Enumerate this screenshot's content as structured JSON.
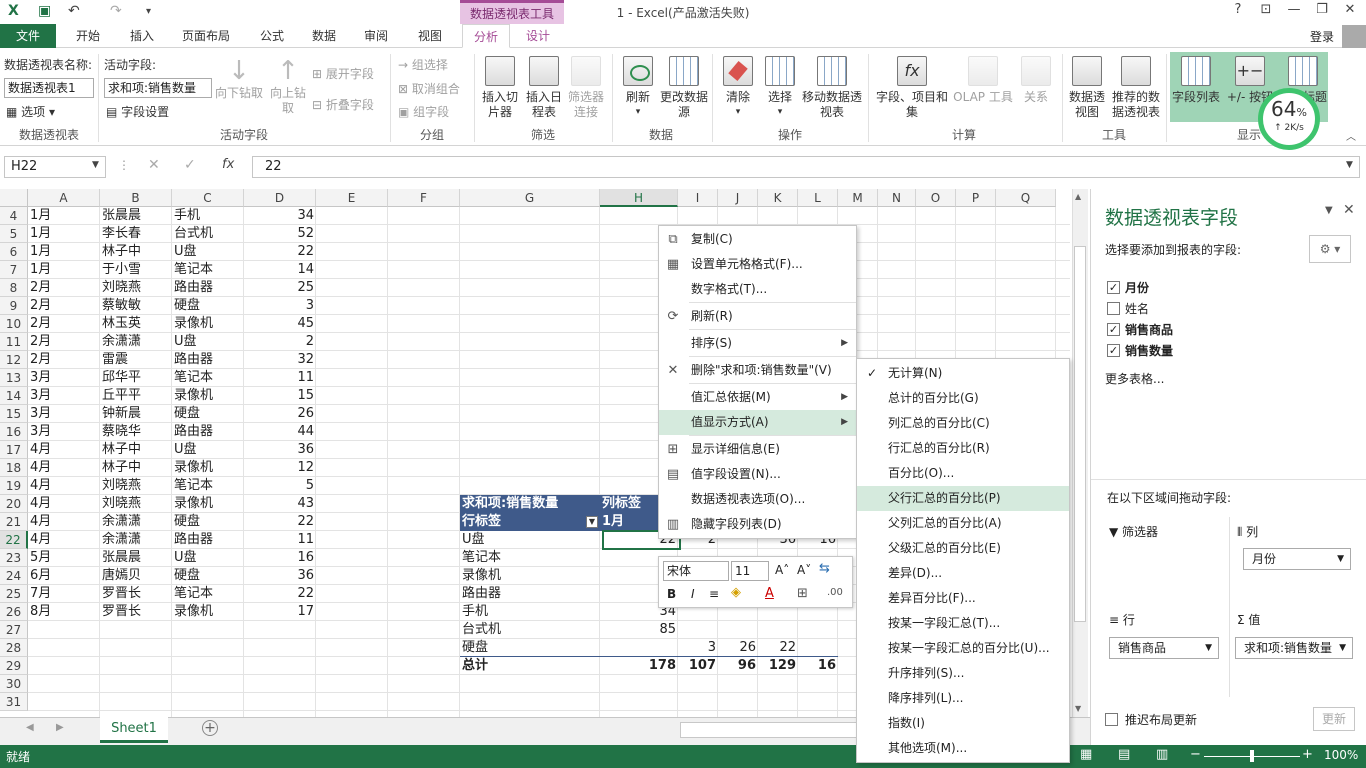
{
  "app": {
    "title": "1 - Excel(产品激活失败)",
    "context_tab_group": "数据透视表工具",
    "login": "登录",
    "help": "?"
  },
  "tabs": [
    "文件",
    "开始",
    "插入",
    "页面布局",
    "公式",
    "数据",
    "审阅",
    "视图",
    "分析",
    "设计"
  ],
  "ribbon": {
    "pivot": {
      "name_label": "数据透视表名称:",
      "name_value": "数据透视表1",
      "options": "选项",
      "group": "数据透视表"
    },
    "active_field": {
      "label": "活动字段:",
      "value": "求和项:销售数量",
      "settings": "字段设置",
      "drill_down": "向下钻取",
      "drill_up": "向上钻取",
      "expand": "展开字段",
      "collapse": "折叠字段",
      "group": "活动字段"
    },
    "grouping": {
      "group_sel": "组选择",
      "ungroup": "取消组合",
      "group_field": "组字段",
      "group": "分组"
    },
    "filter": {
      "slicer": "插入切片器",
      "timeline": "插入日程表",
      "filter_conn": "筛选器连接",
      "group": "筛选"
    },
    "data": {
      "refresh": "刷新",
      "change_source": "更改数据源",
      "group": "数据"
    },
    "actions": {
      "clear": "清除",
      "select": "选择",
      "move": "移动数据透视表",
      "group": "操作"
    },
    "calc": {
      "fields": "字段、项目和集",
      "olap": "OLAP 工具",
      "relations": "关系",
      "group": "计算"
    },
    "tools": {
      "pivotchart": "数据透视图",
      "recommended": "推荐的数据透视表",
      "group": "工具"
    },
    "show": {
      "field_list": "字段列表",
      "buttons": "+/- 按钮",
      "headers": "字段标题",
      "group": "显示"
    }
  },
  "speed": {
    "percent": "64",
    "unit": "%",
    "rate": "2K/s"
  },
  "formula": {
    "cell": "H22",
    "value": "22",
    "fx": "fx"
  },
  "columns": [
    "A",
    "B",
    "C",
    "D",
    "E",
    "F",
    "G",
    "H",
    "I",
    "J",
    "K",
    "L",
    "M",
    "N",
    "O",
    "P",
    "Q"
  ],
  "rows": [
    "4",
    "5",
    "6",
    "7",
    "8",
    "9",
    "10",
    "11",
    "12",
    "13",
    "14",
    "15",
    "16",
    "17",
    "18",
    "19",
    "20",
    "21",
    "22",
    "23",
    "24",
    "25",
    "26",
    "27",
    "28",
    "29",
    "30",
    "31"
  ],
  "table": [
    [
      "1月",
      "张晨晨",
      "手机",
      "34"
    ],
    [
      "1月",
      "李长春",
      "台式机",
      "52"
    ],
    [
      "1月",
      "林子中",
      "U盘",
      "22"
    ],
    [
      "1月",
      "于小雪",
      "笔记本",
      "14"
    ],
    [
      "2月",
      "刘晓燕",
      "路由器",
      "25"
    ],
    [
      "2月",
      "蔡敏敏",
      "硬盘",
      "3"
    ],
    [
      "2月",
      "林玉英",
      "录像机",
      "45"
    ],
    [
      "2月",
      "余潇潇",
      "U盘",
      "2"
    ],
    [
      "2月",
      "雷震",
      "路由器",
      "32"
    ],
    [
      "3月",
      "邱华平",
      "笔记本",
      "11"
    ],
    [
      "3月",
      "丘平平",
      "录像机",
      "15"
    ],
    [
      "3月",
      "钟新晨",
      "硬盘",
      "26"
    ],
    [
      "3月",
      "蔡晓华",
      "路由器",
      "44"
    ],
    [
      "4月",
      "林子中",
      "U盘",
      "36"
    ],
    [
      "4月",
      "林子中",
      "录像机",
      "12"
    ],
    [
      "4月",
      "刘晓燕",
      "笔记本",
      "5"
    ],
    [
      "4月",
      "刘晓燕",
      "录像机",
      "43"
    ],
    [
      "4月",
      "余潇潇",
      "硬盘",
      "22"
    ],
    [
      "4月",
      "余潇潇",
      "路由器",
      "11"
    ],
    [
      "5月",
      "张晨晨",
      "U盘",
      "16"
    ],
    [
      "6月",
      "唐嫣贝",
      "硬盘",
      "36"
    ],
    [
      "7月",
      "罗晋长",
      "笔记本",
      "22"
    ],
    [
      "8月",
      "罗晋长",
      "录像机",
      "17"
    ]
  ],
  "pivot": {
    "header": "求和项:销售数量",
    "col_label": "列标签",
    "row_label": "行标签",
    "first_col": "1月",
    "items": [
      {
        "name": "U盘",
        "h": "22",
        "i": "2",
        "k": "36",
        "l": "16"
      },
      {
        "name": "笔记本",
        "h": "",
        "i": "",
        "k": "",
        "l": ""
      },
      {
        "name": "录像机",
        "h": "",
        "i": "",
        "k": "",
        "l": ""
      },
      {
        "name": "路由器",
        "h": "",
        "i": "",
        "k": "",
        "l": ""
      },
      {
        "name": "手机",
        "h": "34",
        "i": "",
        "k": "",
        "l": ""
      },
      {
        "name": "台式机",
        "h": "85",
        "i": "",
        "k": "",
        "l": ""
      },
      {
        "name": "硬盘",
        "h": "",
        "i": "3",
        "j": "26",
        "k": "22"
      }
    ],
    "total": {
      "name": "总计",
      "h": "178",
      "i": "107",
      "j": "96",
      "k": "129",
      "l": "16"
    }
  },
  "context_menu": [
    {
      "label": "复制(C)",
      "icon": "copy-icon"
    },
    {
      "label": "设置单元格格式(F)...",
      "icon": "format-cells-icon"
    },
    {
      "label": "数字格式(T)...",
      "icon": ""
    },
    {
      "label": "刷新(R)",
      "icon": "refresh-icon"
    },
    {
      "label": "排序(S)",
      "icon": "",
      "sub": true
    },
    {
      "label": "删除\"求和项:销售数量\"(V)",
      "icon": "close-icon"
    },
    {
      "label": "值汇总依据(M)",
      "icon": "",
      "sub": true
    },
    {
      "label": "值显示方式(A)",
      "icon": "",
      "sub": true,
      "active": true
    },
    {
      "label": "显示详细信息(E)",
      "icon": "detail-icon"
    },
    {
      "label": "值字段设置(N)...",
      "icon": "field-settings-icon"
    },
    {
      "label": "数据透视表选项(O)...",
      "icon": ""
    },
    {
      "label": "隐藏字段列表(D)",
      "icon": "field-list-icon"
    }
  ],
  "submenu": [
    "无计算(N)",
    "总计的百分比(G)",
    "列汇总的百分比(C)",
    "行汇总的百分比(R)",
    "百分比(O)...",
    "父行汇总的百分比(P)",
    "父列汇总的百分比(A)",
    "父级汇总的百分比(E)",
    "差异(D)...",
    "差异百分比(F)...",
    "按某一字段汇总(T)...",
    "按某一字段汇总的百分比(U)...",
    "升序排列(S)...",
    "降序排列(L)...",
    "指数(I)",
    "其他选项(M)..."
  ],
  "mini_toolbar": {
    "font": "宋体",
    "size": "11"
  },
  "pane": {
    "title": "数据透视表字段",
    "subtitle": "选择要添加到报表的字段:",
    "fields": [
      {
        "name": "月份",
        "checked": true
      },
      {
        "name": "姓名",
        "checked": false
      },
      {
        "name": "销售商品",
        "checked": true
      },
      {
        "name": "销售数量",
        "checked": true
      }
    ],
    "more": "更多表格...",
    "drag_label": "在以下区域间拖动字段:",
    "filters": "筛选器",
    "columns": "列",
    "col_value": "月份",
    "rows": "行",
    "row_value": "销售商品",
    "values": "值",
    "val_value": "求和项:销售数量",
    "defer": "推迟布局更新",
    "update": "更新"
  },
  "sheet": {
    "tab": "Sheet1"
  },
  "status": {
    "ready": "就绪",
    "zoom": "100%"
  }
}
